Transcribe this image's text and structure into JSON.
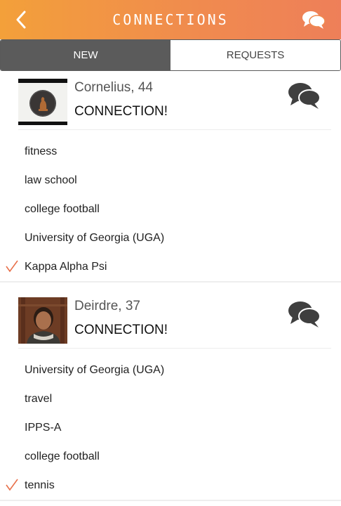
{
  "header": {
    "title": "CONNECTIONS",
    "back_icon": "chevron-left-icon",
    "chat_icon": "chat-bubbles-icon",
    "color": "#f3a03a"
  },
  "tabs": [
    {
      "label": "NEW",
      "active": true
    },
    {
      "label": "REQUESTS",
      "active": false
    }
  ],
  "connections": [
    {
      "name": "Cornelius, 44",
      "status": "CONNECTION!",
      "tags": [
        {
          "label": "fitness",
          "checked": false
        },
        {
          "label": "law school",
          "checked": false
        },
        {
          "label": "college football",
          "checked": false
        },
        {
          "label": "University of Georgia (UGA)",
          "checked": false
        },
        {
          "label": "Kappa Alpha Psi",
          "checked": true
        }
      ]
    },
    {
      "name": "Deirdre, 37",
      "status": "CONNECTION!",
      "tags": [
        {
          "label": "University of Georgia (UGA)",
          "checked": false
        },
        {
          "label": "travel",
          "checked": false
        },
        {
          "label": "IPPS-A",
          "checked": false
        },
        {
          "label": "college football",
          "checked": false
        },
        {
          "label": "tennis",
          "checked": true
        }
      ]
    }
  ],
  "colors": {
    "accent": "#f08a4f",
    "check": "#e8704a",
    "tab_active": "#5b5b5b"
  }
}
